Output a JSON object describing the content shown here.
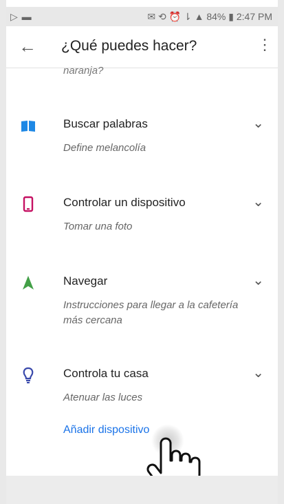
{
  "status_bar": {
    "left_icons": "▷ ▬",
    "right_text": "✉ ⟲ ⏰ ⇂ ▲ 84% ▮ 2:47 PM"
  },
  "app_bar": {
    "title": "¿Qué puedes hacer?",
    "back_icon": "arrow-back-icon",
    "more_icon": "more-vert-icon"
  },
  "previous_item_text": "naranja?",
  "items": [
    {
      "title": "Buscar palabras",
      "subtitle": "Define melancolía",
      "icon": "book-icon",
      "icon_color": "#1e88e5"
    },
    {
      "title": "Controlar un dispositivo",
      "subtitle": "Tomar una foto",
      "icon": "phone-icon",
      "icon_color": "#c51162"
    },
    {
      "title": "Navegar",
      "subtitle": "Instrucciones para llegar a la cafetería más cercana",
      "icon": "navigation-arrow-icon",
      "icon_color": "#43a047"
    },
    {
      "title": "Controla tu casa",
      "subtitle": "Atenuar las luces",
      "icon": "lightbulb-icon",
      "icon_color": "#3949ab"
    }
  ],
  "link": {
    "label": "Añadir dispositivo"
  },
  "colors": {
    "link": "#1a73e8",
    "text": "#222222",
    "subtitle": "#666666"
  }
}
